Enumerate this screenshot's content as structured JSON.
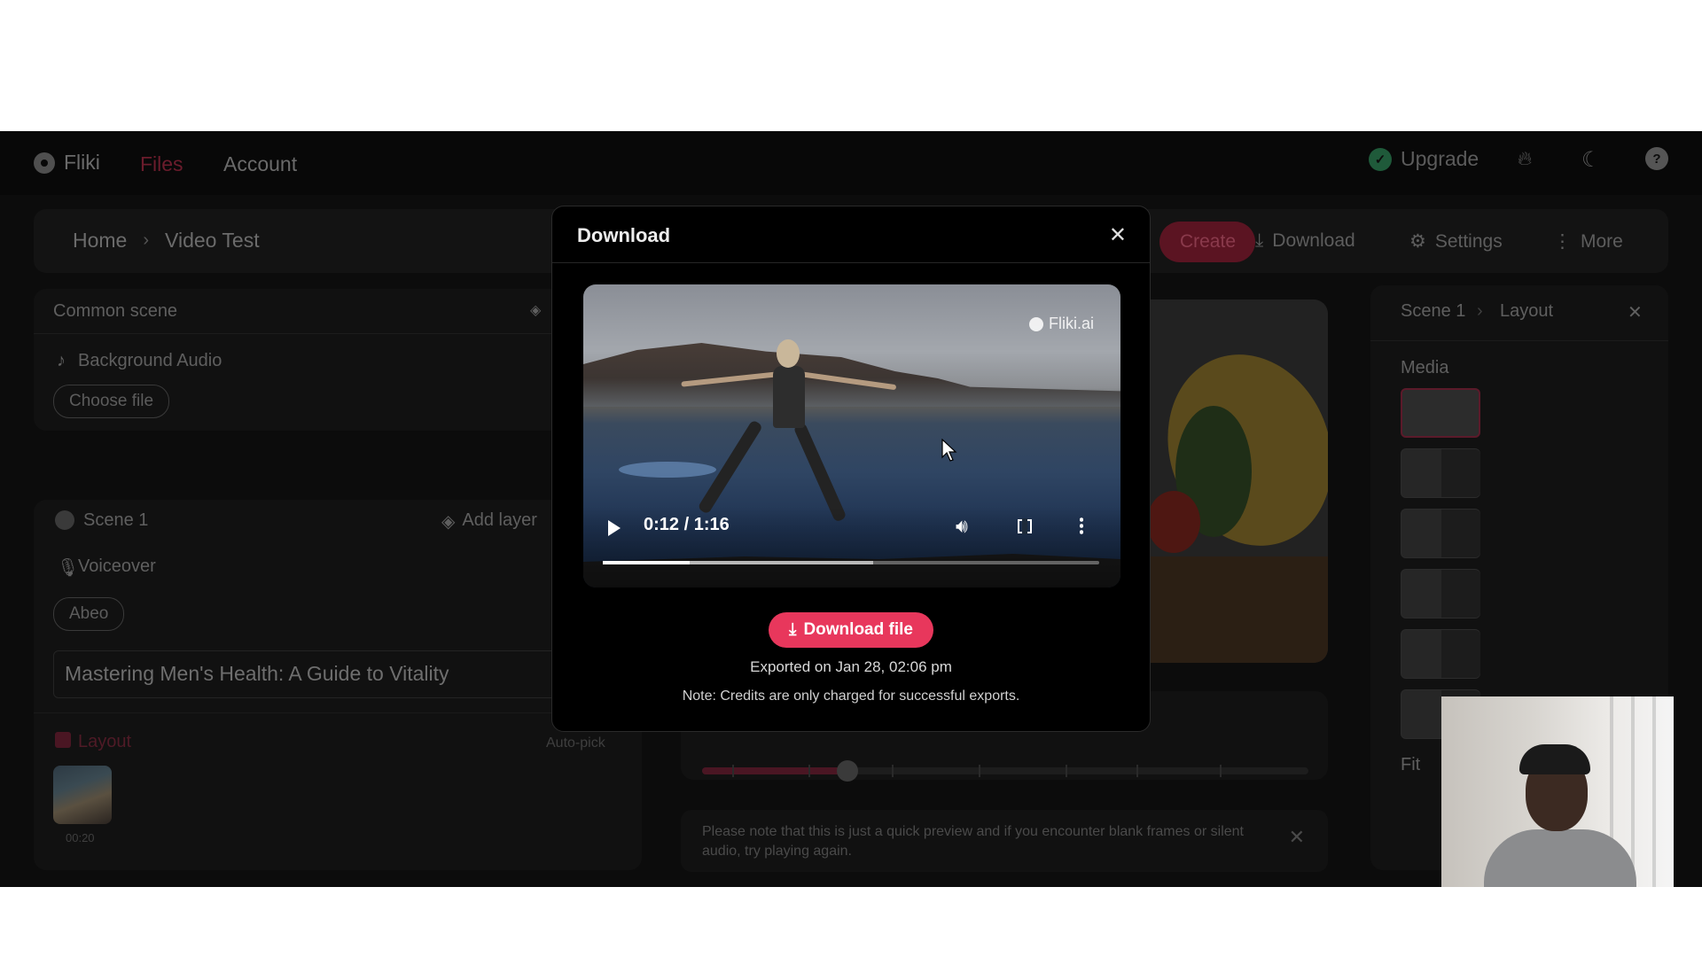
{
  "nav": {
    "brand": "Fliki",
    "files": "Files",
    "account": "Account",
    "upgrade": "Upgrade"
  },
  "breadcrumb": {
    "home": "Home",
    "current": "Video Test"
  },
  "actions": {
    "create": "Create",
    "download": "Download",
    "settings": "Settings",
    "more": "More"
  },
  "left": {
    "common_scene": "Common scene",
    "bg_audio": "Background Audio",
    "choose_file": "Choose file",
    "scene_title": "Scene 1",
    "add_layer": "Add layer",
    "voiceover": "Voiceover",
    "voice_chip": "Abeo",
    "script_text": "Mastering Men's Health: A Guide to Vitality",
    "layout_label": "Layout",
    "auto_pick": "Auto-pick",
    "thumb_duration": "00:20"
  },
  "center": {
    "preview_note": "Please note that this is just a quick preview and if you encounter blank frames or silent audio, try playing again."
  },
  "right": {
    "scene": "Scene 1",
    "layout": "Layout",
    "media": "Media",
    "fit": "Fit"
  },
  "modal": {
    "title": "Download",
    "watermark": "Fliki.ai",
    "time": "0:12 / 1:16",
    "played_fraction": 0.175,
    "buffered_fraction": 0.545,
    "download_button": "Download file",
    "exported": "Exported on Jan 28, 02:06 pm",
    "note": "Note: Credits are only charged for successful exports."
  },
  "colors": {
    "accent": "#e8375c",
    "upgrade_icon": "#1f5a3a"
  }
}
